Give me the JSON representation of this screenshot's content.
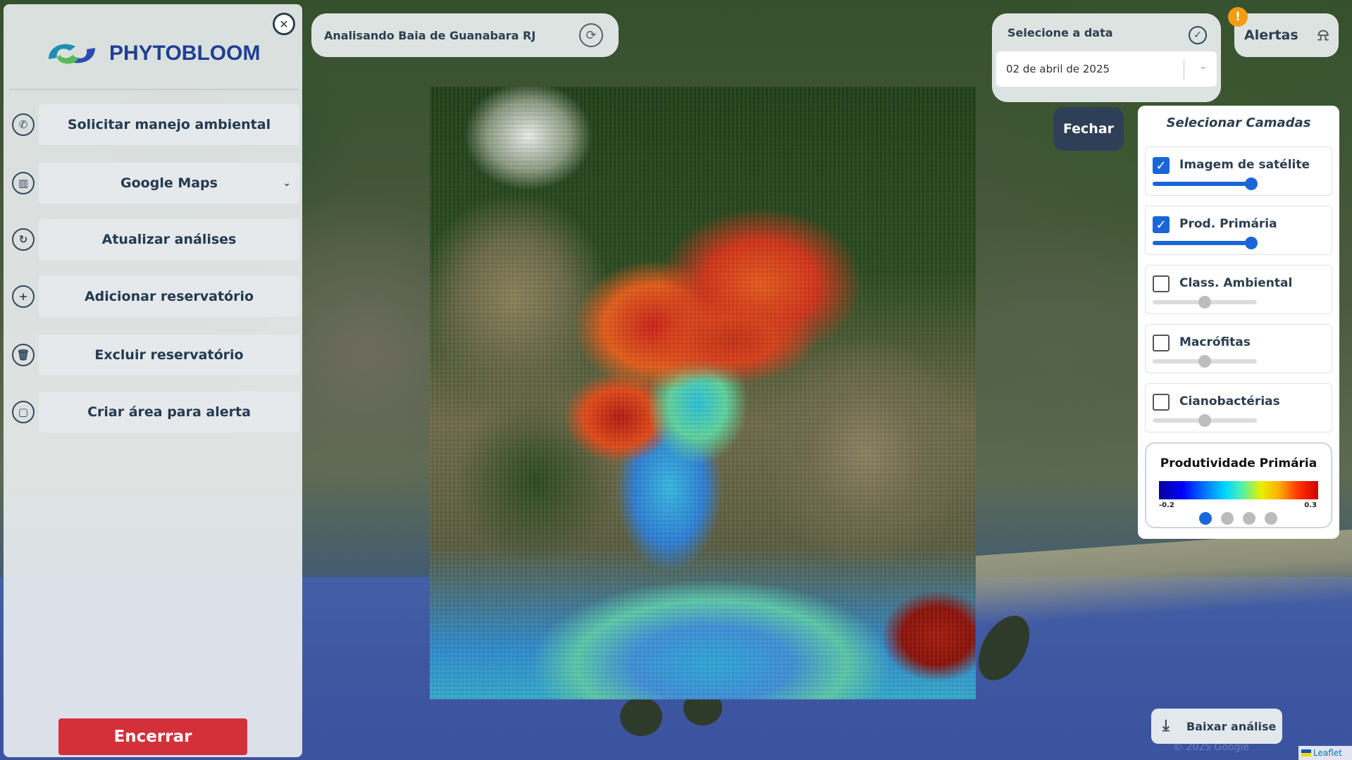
{
  "app": {
    "name": "PHYTOBLOOM"
  },
  "sidebar": {
    "close_icon": "close-icon",
    "items": [
      {
        "label": "Solicitar manejo ambiental",
        "icon": "phone-icon"
      },
      {
        "label": "Google Maps",
        "icon": "map-icon",
        "has_dropdown": true
      },
      {
        "label": "Atualizar análises",
        "icon": "refresh-icon"
      },
      {
        "label": "Adicionar reservatório",
        "icon": "plus-icon"
      },
      {
        "label": "Excluir reservatório",
        "icon": "trash-icon"
      },
      {
        "label": "Criar área para alerta",
        "icon": "area-icon"
      }
    ],
    "end_button": "Encerrar"
  },
  "topbar": {
    "analyzing_text": "Analisando Baia de Guanabara RJ"
  },
  "date": {
    "label": "Selecione a data",
    "selected": "02 de abril de 2025"
  },
  "alerts": {
    "label": "Alertas",
    "badge": "!"
  },
  "fechar_label": "Fechar",
  "layers": {
    "title": "Selecionar Camadas",
    "items": [
      {
        "label": "Imagem de satélite",
        "checked": true,
        "opacity": 0.9
      },
      {
        "label": "Prod. Primária",
        "checked": true,
        "opacity": 0.9
      },
      {
        "label": "Class. Ambiental",
        "checked": false,
        "opacity": 0.5
      },
      {
        "label": "Macrófitas",
        "checked": false,
        "opacity": 0.5
      },
      {
        "label": "Cianobactérias",
        "checked": false,
        "opacity": 0.5
      }
    ]
  },
  "legend": {
    "title": "Produtividade Primária",
    "min": "-0.2",
    "max": "0.3",
    "pages": 4,
    "active_page": 1
  },
  "download_label": "Baixar análise",
  "attribution": "Leaflet",
  "copyright": "© 2025 Google",
  "colors": {
    "brand": "#1f3f94",
    "accent": "#1a66d8",
    "danger": "#d3303a",
    "dark": "#2f3f57"
  }
}
